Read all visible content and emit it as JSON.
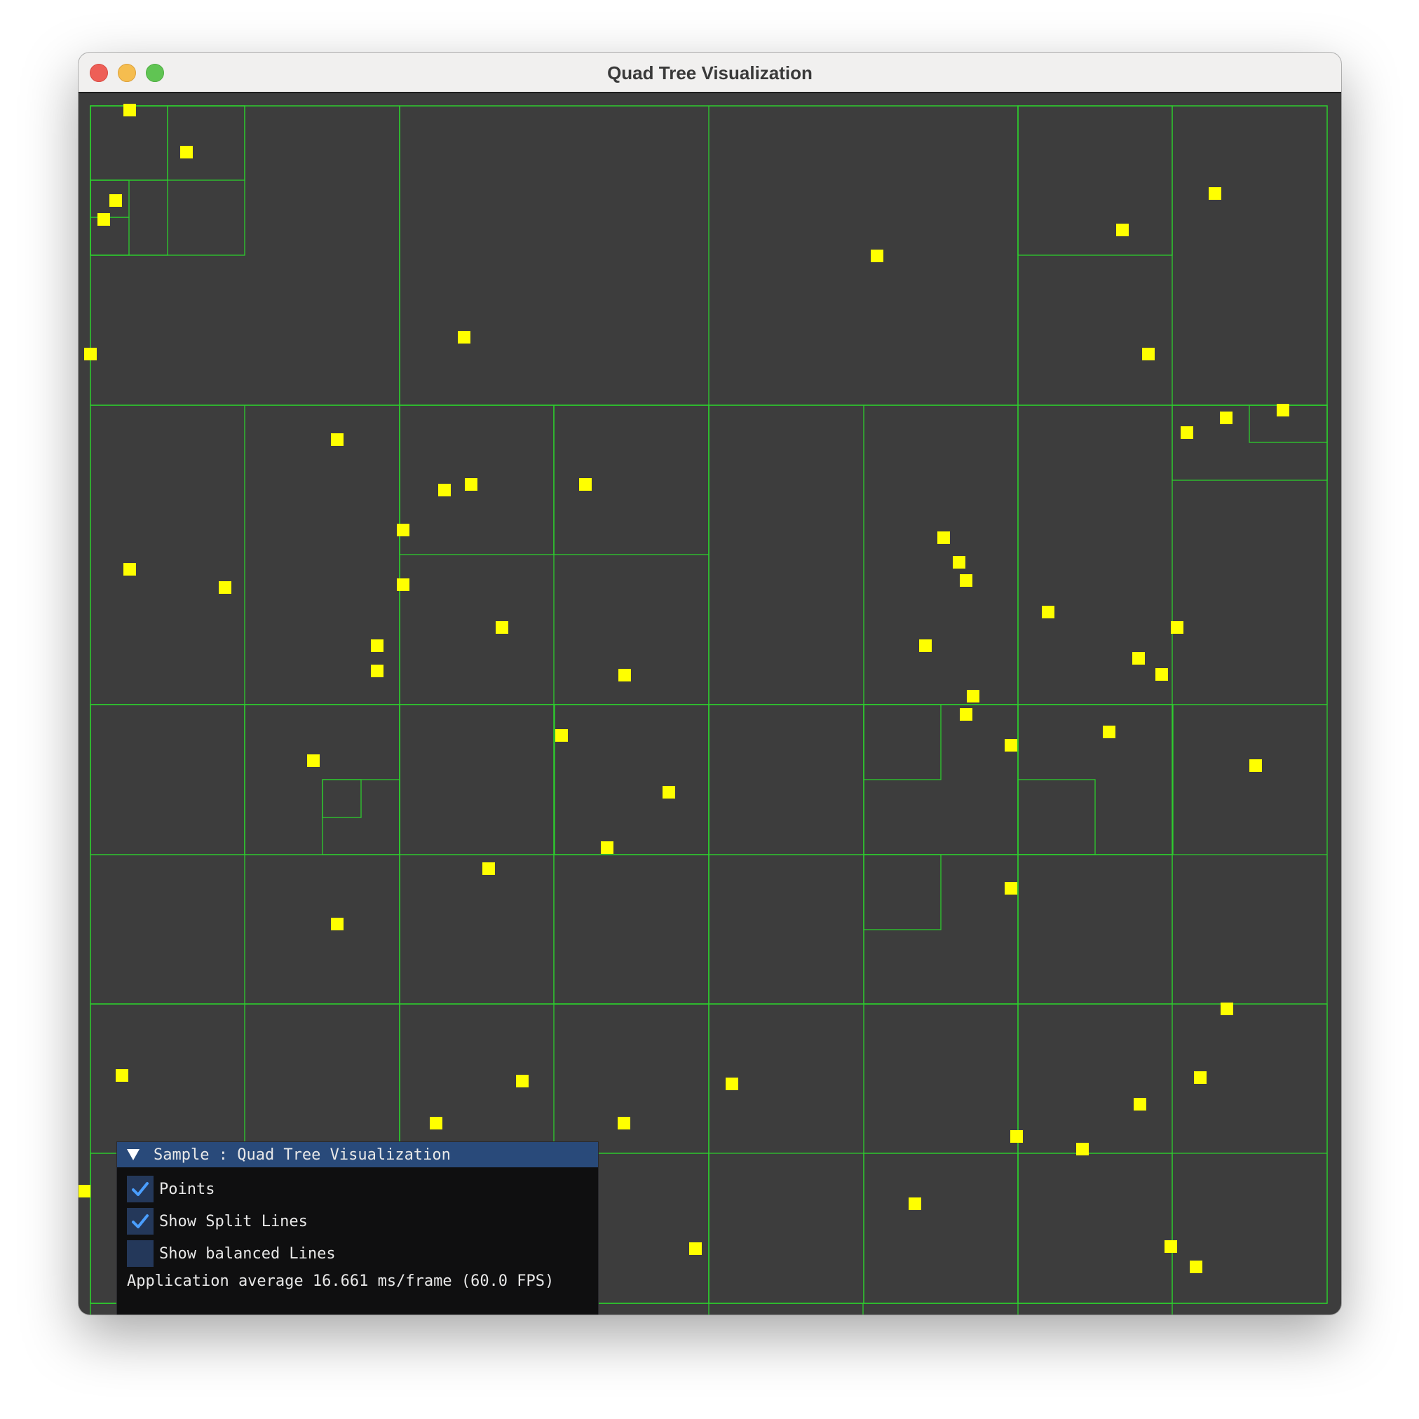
{
  "window": {
    "title": "Quad Tree Visualization"
  },
  "colors": {
    "canvas_background": "#3d3d3d",
    "split_line": "#2ecc2e",
    "point": "#ffff00",
    "panel_header": "#294a7a",
    "checkbox_bg": "#24385a",
    "checkmark": "#4a9eff"
  },
  "panel": {
    "title": "Sample : Quad Tree Visualization",
    "options": [
      {
        "label": "Points",
        "checked": true
      },
      {
        "label": "Show Split Lines",
        "checked": true
      },
      {
        "label": "Show balanced Lines",
        "checked": false
      }
    ],
    "stats": "Application average 16.661 ms/frame (60.0 FPS)"
  }
}
